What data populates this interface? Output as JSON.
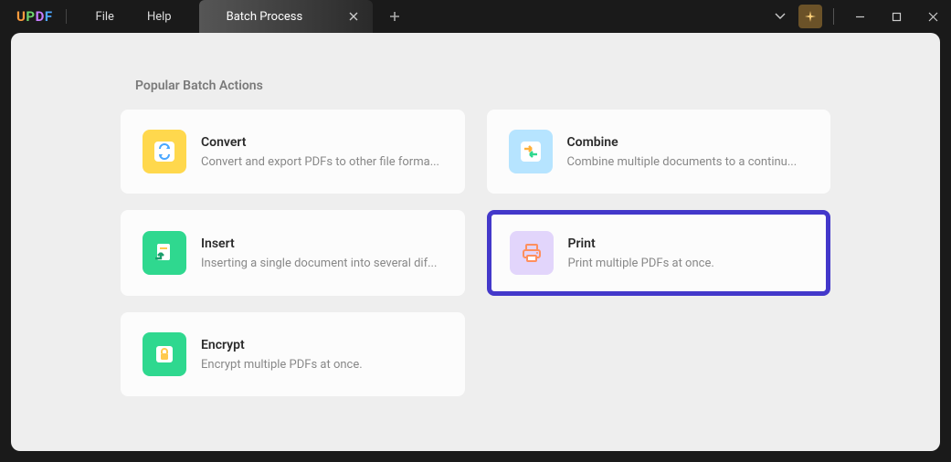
{
  "app": {
    "logo_chars": [
      "U",
      "P",
      "D",
      "F"
    ]
  },
  "menu": {
    "file": "File",
    "help": "Help"
  },
  "tab": {
    "title": "Batch Process"
  },
  "section": {
    "title": "Popular Batch Actions"
  },
  "cards": {
    "convert": {
      "title": "Convert",
      "desc": "Convert and export PDFs to other file forma..."
    },
    "combine": {
      "title": "Combine",
      "desc": "Combine multiple documents to a continu..."
    },
    "insert": {
      "title": "Insert",
      "desc": "Inserting a single document into several dif..."
    },
    "print": {
      "title": "Print",
      "desc": "Print multiple PDFs at once."
    },
    "encrypt": {
      "title": "Encrypt",
      "desc": "Encrypt multiple PDFs at once."
    }
  }
}
